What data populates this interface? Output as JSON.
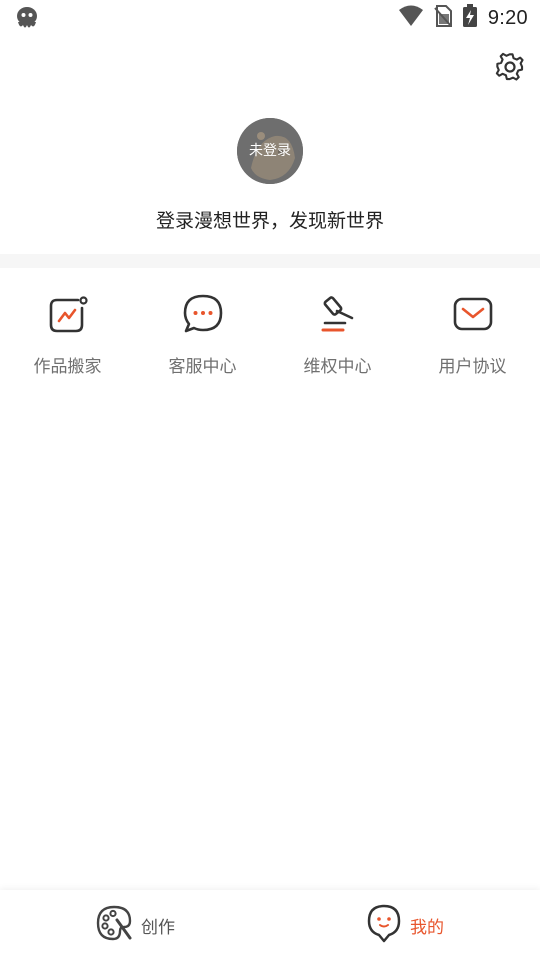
{
  "status_bar": {
    "time": "9:20",
    "icons": [
      "octopus-app-icon",
      "wifi-icon",
      "no-sim-icon",
      "battery-charging-icon"
    ]
  },
  "header": {
    "settings_icon": "gear-icon"
  },
  "profile": {
    "avatar_label": "未登录",
    "slogan": "登录漫想世界，发现新世界"
  },
  "menu": {
    "items": [
      {
        "label": "作品搬家",
        "icon": "trend-card-icon"
      },
      {
        "label": "客服中心",
        "icon": "chat-bubble-icon"
      },
      {
        "label": "维权中心",
        "icon": "gavel-icon"
      },
      {
        "label": "用户协议",
        "icon": "envelope-icon"
      }
    ]
  },
  "bottom_nav": {
    "tabs": [
      {
        "label": "创作",
        "icon": "palette-icon",
        "active": false
      },
      {
        "label": "我的",
        "icon": "smiley-pin-icon",
        "active": true
      }
    ]
  },
  "colors": {
    "accent": "#e8552c",
    "icon_dark": "#333333",
    "label_gray": "#707070",
    "divider": "#f6f6f6"
  }
}
